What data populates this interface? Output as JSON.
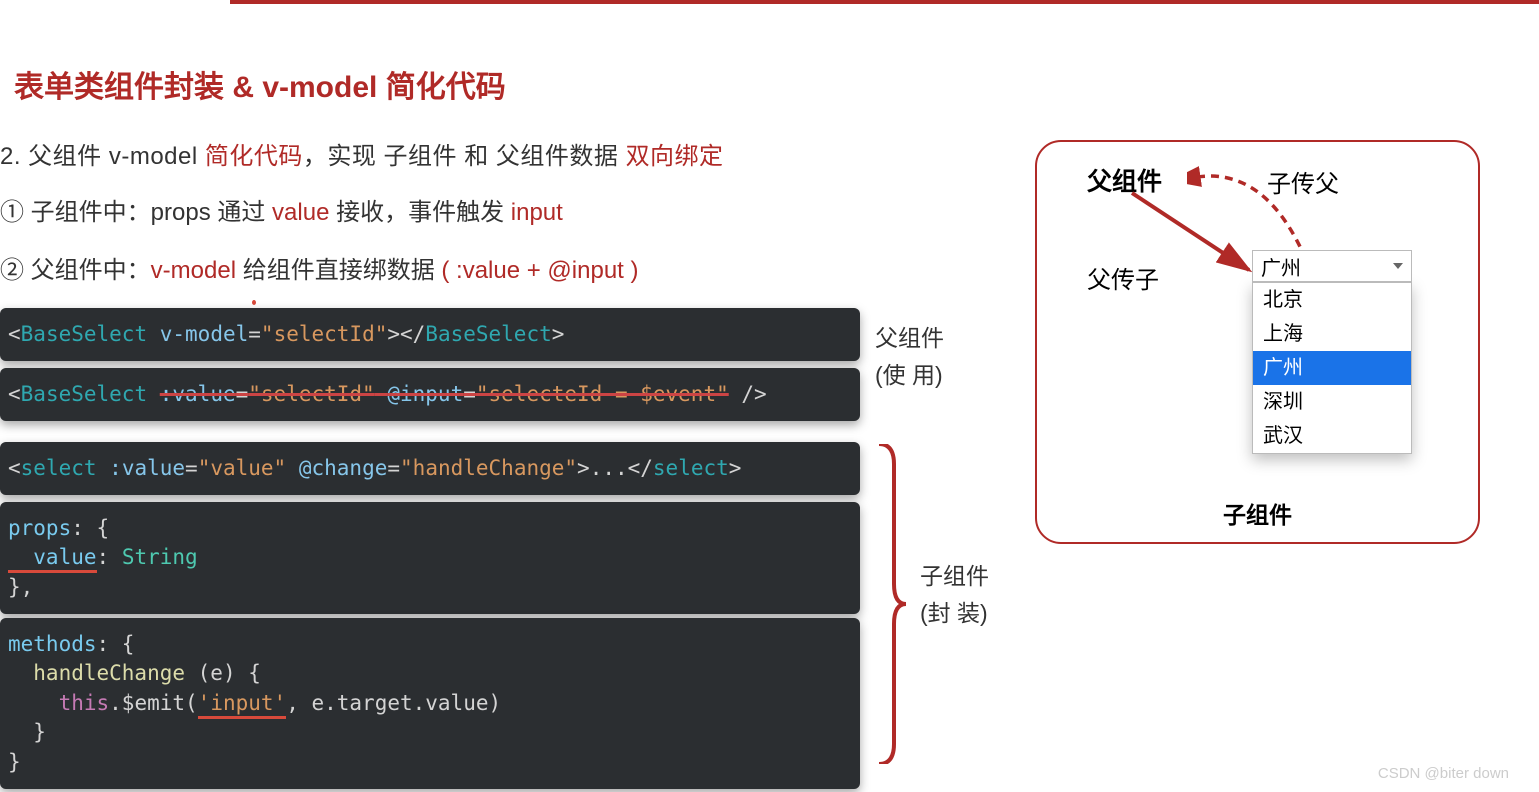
{
  "title": "表单类组件封装 & v-model 简化代码",
  "line2": {
    "prefix": "2. 父组件 v-model ",
    "red1": "简化代码",
    "mid": "，实现 子组件 和 父组件数据 ",
    "red2": "双向绑定"
  },
  "line3": {
    "prefix": "① 子组件中：props 通过 ",
    "red1": "value",
    "mid": " 接收，事件触发 ",
    "red2": "input"
  },
  "line4": {
    "prefix": "② 父组件中：",
    "red1": "v-model",
    "mid": " 给组件直接绑数据   ",
    "red2": "( :value + @input )"
  },
  "parent_label": "父组件",
  "parent_use": "(使  用)",
  "child_label": "子组件",
  "child_wrap": "(封  装)",
  "diagram": {
    "parent": "父组件",
    "c2p": "子传父",
    "p2c": "父传子",
    "child": "子组件",
    "selected": "广州",
    "options": [
      "北京",
      "上海",
      "广州",
      "深圳",
      "武汉"
    ]
  },
  "code": {
    "c1_open": "<BaseSelect ",
    "c1_attr": "v-model",
    "c1_eq": "=",
    "c1_val": "\"selectId\"",
    "c1_close": "></BaseSelect>",
    "c2_open": "<BaseSelect ",
    "c2_a1": ":value",
    "c2_v1": "\"selectId\"",
    "c2_a2": "@input",
    "c2_v2": "\"selecteId = $event\"",
    "c2_end": " />",
    "c3_open": "<select ",
    "c3_a1": ":value",
    "c3_v1": "\"value\"",
    "c3_a2": "@change",
    "c3_v2": "\"handleChange\"",
    "c3_mid": ">...</",
    "c3_tag2": "select",
    "c3_end": ">",
    "c4_l1_k": "props",
    "c4_l1_r": ": {",
    "c4_l2_k": "  value",
    "c4_l2_c": ": ",
    "c4_l2_t": "String",
    "c4_l3": "},",
    "c5_l1_k": "methods",
    "c5_l1_r": ": {",
    "c5_l2_fn": "  handleChange",
    "c5_l2_r": " (e) {",
    "c5_l3_a": "    this",
    "c5_l3_b": ".$emit(",
    "c5_l3_s": "'input'",
    "c5_l3_c": ", e.target.value)",
    "c5_l4": "  }",
    "c5_l5": "}"
  },
  "watermark": "CSDN @biter down"
}
